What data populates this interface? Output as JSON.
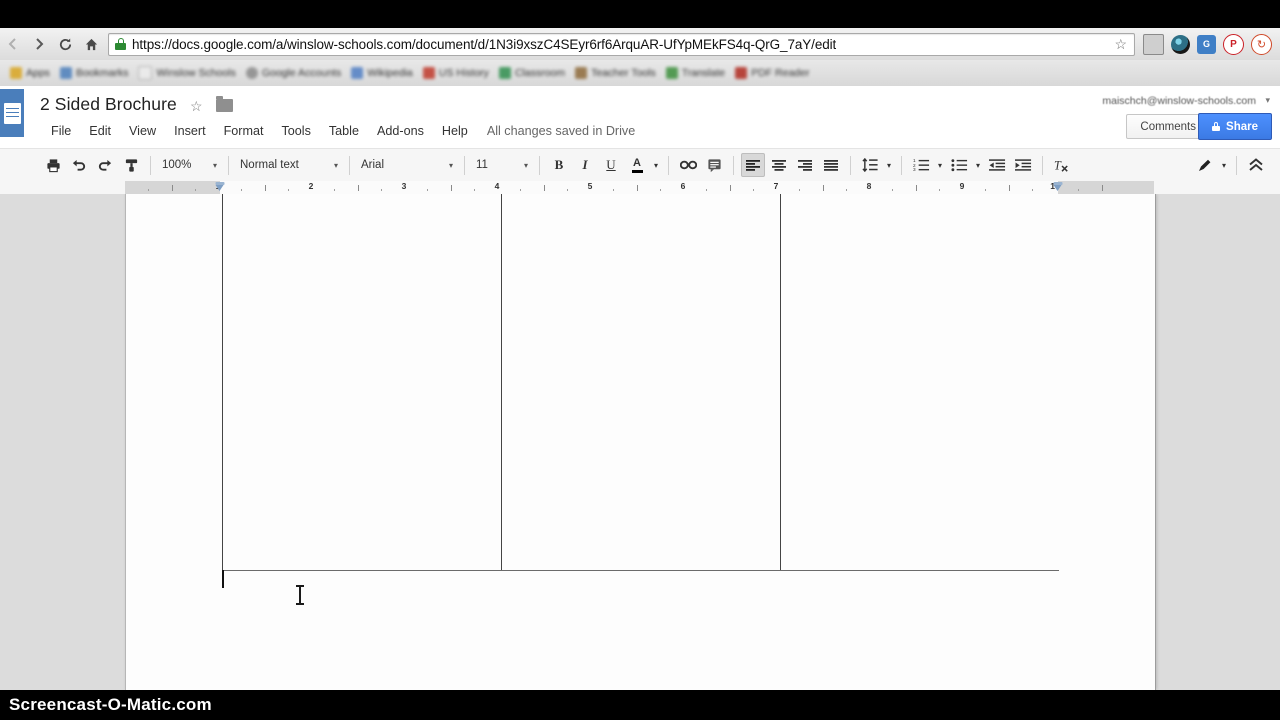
{
  "browser": {
    "nav": {
      "back_label": "←",
      "forward_label": "→",
      "reload_label": "C",
      "home_label": "⌂"
    },
    "omnibox": {
      "url": "https://docs.google.com/a/winslow-schools.com/document/d/1N3i9xszC4SEyr6rf6ArquAR-UfYpMEkFS4q-QrG_7aY/edit",
      "security_icon": "lock-icon",
      "bookmark_star": "☆"
    },
    "extensions": [
      {
        "name": "screen-capture-icon",
        "glyph": "▭",
        "color": "#9a9a9a"
      },
      {
        "name": "camera-icon",
        "glyph": "◉",
        "color": "#3c3c3c"
      },
      {
        "name": "grammarly-icon",
        "glyph": "G",
        "color": "#2f7ec9"
      },
      {
        "name": "pinterest-icon",
        "glyph": "P",
        "color": "#cb2027"
      },
      {
        "name": "rotate-icon",
        "glyph": "↻",
        "color": "#d04a2a"
      }
    ],
    "bookmarks": [
      {
        "label": "Apps",
        "color": "#d9a520"
      },
      {
        "label": "Bookmarks",
        "color": "#4a7ebb"
      },
      {
        "label": "Winslow Schools",
        "color": "#e8e8e8"
      },
      {
        "label": "Google Accounts",
        "color": "#888888"
      },
      {
        "label": "Wikipedia",
        "color": "#4f7ec4"
      },
      {
        "label": "US History",
        "color": "#c0392b"
      },
      {
        "label": "Classroom",
        "color": "#2f8f4e"
      },
      {
        "label": "Teacher Tools",
        "color": "#8e6a3a"
      },
      {
        "label": "Translate",
        "color": "#3b8f3b"
      },
      {
        "label": "PDF Reader",
        "color": "#b02a1f"
      }
    ]
  },
  "docs": {
    "app_icon": "google-docs-icon",
    "title": "2 Sided Brochure",
    "star_glyph": "☆",
    "folder_icon": "move-to-folder-icon",
    "menus": [
      "File",
      "Edit",
      "View",
      "Insert",
      "Format",
      "Tools",
      "Table",
      "Add-ons",
      "Help"
    ],
    "save_status": "All changes saved in Drive",
    "account_email": "maischch@winslow-schools.com",
    "account_caret": "▾",
    "comments_label": "Comments",
    "share_label": "Share",
    "accent_blue": "#4d90fe",
    "logo_blue": "#4a7ebb"
  },
  "toolbar": {
    "print": {
      "name": "print-icon",
      "glyph": "⎙"
    },
    "undo": {
      "name": "undo-icon",
      "glyph": "↶"
    },
    "redo": {
      "name": "redo-icon",
      "glyph": "↷"
    },
    "paint_format": {
      "name": "paint-format-icon",
      "glyph": "✒"
    },
    "zoom": {
      "value": "100%",
      "caret": "▾"
    },
    "style": {
      "value": "Normal text",
      "caret": "▾"
    },
    "font": {
      "value": "Arial",
      "caret": "▾"
    },
    "size": {
      "value": "11",
      "caret": "▾"
    },
    "bold": {
      "name": "bold-icon",
      "glyph": "B"
    },
    "italic": {
      "name": "italic-icon",
      "glyph": "I"
    },
    "underline": {
      "name": "underline-icon",
      "glyph": "U"
    },
    "text_color": {
      "name": "text-color-icon",
      "glyph": "A",
      "color": "#000000",
      "caret": "▾"
    },
    "link": {
      "name": "insert-link-icon",
      "glyph": "⚭"
    },
    "comment": {
      "name": "insert-comment-icon",
      "glyph": "▤"
    },
    "align_left": {
      "name": "align-left-icon",
      "active": true
    },
    "align_center": {
      "name": "align-center-icon",
      "active": false
    },
    "align_right": {
      "name": "align-right-icon",
      "active": false
    },
    "align_justify": {
      "name": "align-justify-icon",
      "active": false
    },
    "line_spacing": {
      "name": "line-spacing-icon",
      "caret": "▾"
    },
    "numbered_list": {
      "name": "numbered-list-icon",
      "caret": "▾"
    },
    "bulleted_list": {
      "name": "bulleted-list-icon",
      "caret": "▾"
    },
    "indent_less": {
      "name": "decrease-indent-icon"
    },
    "indent_more": {
      "name": "increase-indent-icon"
    },
    "clear_formatting": {
      "name": "clear-formatting-icon",
      "glyph": "✕"
    },
    "edit_mode": {
      "name": "edit-mode-pencil-icon",
      "caret": "▾"
    },
    "collapse": {
      "name": "collapse-toolbar-icon",
      "glyph": "«"
    }
  },
  "ruler": {
    "unit": "inches",
    "numbers": [
      "1",
      "2",
      "3",
      "4",
      "5",
      "6",
      "7",
      "8",
      "9",
      "10"
    ],
    "left_margin_in": 0.5,
    "right_margin_in": 9.5,
    "total_in": 10.5
  },
  "document": {
    "table": {
      "rows": 1,
      "columns": 3,
      "cells": [
        "",
        "",
        ""
      ]
    },
    "cursor": "text-cursor"
  },
  "watermark": {
    "text": "Screencast-O-Matic.com"
  }
}
